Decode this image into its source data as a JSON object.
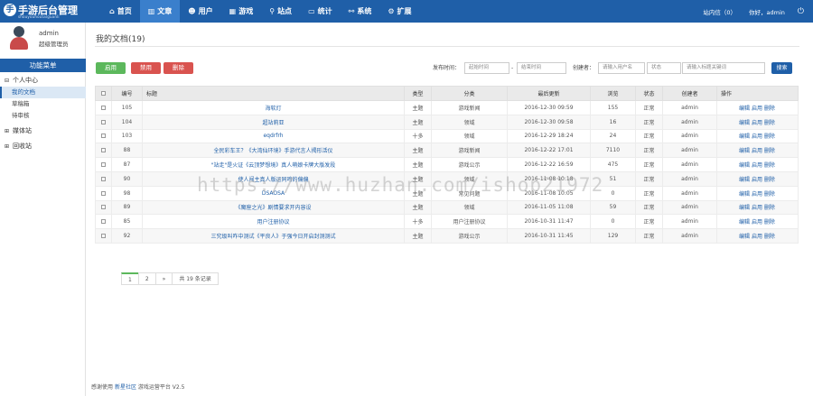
{
  "logo": {
    "mark": "手",
    "title": "手游后台管理",
    "subtitle": "shouyouhoutaiguanli"
  },
  "nav": [
    {
      "icon": "⌂",
      "label": "首页"
    },
    {
      "icon": "▥",
      "label": "文章"
    },
    {
      "icon": "☻",
      "label": "用户"
    },
    {
      "icon": "▦",
      "label": "游戏"
    },
    {
      "icon": "⚲",
      "label": "站点"
    },
    {
      "icon": "▭",
      "label": "统计"
    },
    {
      "icon": "⚯",
      "label": "系统"
    },
    {
      "icon": "⚙",
      "label": "扩展"
    }
  ],
  "top_right": {
    "messages": "站内信（0）",
    "greeting": "你好，admin",
    "power_icon": "⏻"
  },
  "user": {
    "name": "admin",
    "role": "超级管理员"
  },
  "sidebar": {
    "menu_title": "功能菜单",
    "group_personal": "个人中心",
    "sub_items": [
      "我的文档",
      "草稿箱",
      "待审核"
    ],
    "group_media": "媒体站",
    "group_recycle": "回收站"
  },
  "page_title": "我的文档(19)",
  "buttons": {
    "enable": "启用",
    "disable": "禁用",
    "delete": "删除",
    "search": "搜索"
  },
  "filters": {
    "publish_time_label": "发布时间：",
    "start_placeholder": "起始时间",
    "to": "-",
    "end_placeholder": "结束时间",
    "author_label": "创建者：",
    "author_placeholder": "请输入用户名",
    "status_placeholder": "状态",
    "keyword_placeholder": "请输入标题关键词"
  },
  "table": {
    "headers": [
      "",
      "编号",
      "标题",
      "类型",
      "分类",
      "最后更新",
      "浏览",
      "状态",
      "创建者",
      "操作"
    ],
    "rows": [
      {
        "id": "105",
        "title": "海软灯",
        "type": "主题",
        "category": "游戏新闻",
        "updated": "2016-12-30 09:59",
        "views": "155",
        "status": "正常",
        "author": "admin"
      },
      {
        "id": "104",
        "title": "超站莉亚",
        "type": "主题",
        "category": "领域",
        "updated": "2016-12-30 09:58",
        "views": "16",
        "status": "正常",
        "author": "admin"
      },
      {
        "id": "103",
        "title": "eqdrfrh",
        "type": "十多",
        "category": "领域",
        "updated": "2016-12-29 18:24",
        "views": "24",
        "status": "正常",
        "author": "admin"
      },
      {
        "id": "88",
        "title": "全民彩车王？《大湾仙环境》手游代言人揭形活仪",
        "type": "主题",
        "category": "游戏新闻",
        "updated": "2016-12-22 17:01",
        "views": "7110",
        "status": "正常",
        "author": "admin"
      },
      {
        "id": "87",
        "title": "\"站走\"是火证《云顶梦想境》真人萌娘卡牌大版发段",
        "type": "主题",
        "category": "游戏公示",
        "updated": "2016-12-22 16:59",
        "views": "475",
        "status": "正常",
        "author": "admin"
      },
      {
        "id": "90",
        "title": "使人闯主真人版运同鸣的偏偏",
        "type": "主题",
        "category": "领域",
        "updated": "2016-11-08 10:18",
        "views": "51",
        "status": "正常",
        "author": "admin"
      },
      {
        "id": "98",
        "title": "DSAOSA",
        "type": "主题",
        "category": "常见问题",
        "updated": "2016-11-08 10:05",
        "views": "0",
        "status": "正常",
        "author": "admin"
      },
      {
        "id": "89",
        "title": "《魔座之光》剧情要求开内容设",
        "type": "主题",
        "category": "领域",
        "updated": "2016-11-05 11:08",
        "views": "59",
        "status": "正常",
        "author": "admin"
      },
      {
        "id": "85",
        "title": "用户注册协议",
        "type": "十多",
        "category": "用户注册协议",
        "updated": "2016-10-31 11:47",
        "views": "0",
        "status": "正常",
        "author": "admin"
      },
      {
        "id": "92",
        "title": "三究级叫咋中测试《平良人》于强今日开启封测测试",
        "type": "主题",
        "category": "游戏公示",
        "updated": "2016-10-31 11:45",
        "views": "129",
        "status": "正常",
        "author": "admin"
      }
    ],
    "ops": [
      "编辑",
      "启用",
      "删除"
    ]
  },
  "pager": {
    "pages": [
      "1",
      "2",
      "»"
    ],
    "summary": "共 19 条记录"
  },
  "footer": {
    "prefix": "感谢使用",
    "link": "新星社区",
    "suffix": "游戏运营平台 V2.5"
  },
  "watermark": "https://www.huzhan.com/ishop21972",
  "colors": {
    "brand": "#1f5fa8",
    "success": "#5cb85c",
    "danger": "#d9534f"
  }
}
